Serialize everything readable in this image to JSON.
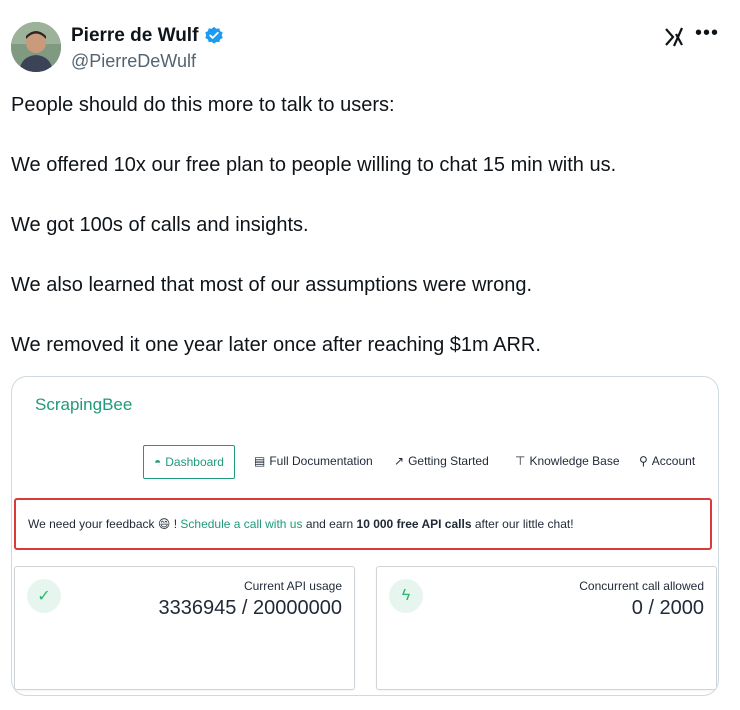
{
  "author": {
    "name": "Pierre de Wulf",
    "handle": "@PierreDeWulf"
  },
  "icons": {
    "verified": "verified-badge-icon",
    "x_logo": "x-grok-logo-icon",
    "more": "more-options-icon"
  },
  "tweet": {
    "lines": [
      "People should do this more to talk to users:",
      "We offered 10x our free plan to people willing to chat 15 min with us.",
      "We got 100s of calls and insights.",
      "We also learned that most of our assumptions were wrong.",
      "We removed it one year later once after reaching $1m ARR."
    ]
  },
  "screenshot": {
    "brand": "ScrapingBee",
    "nav": [
      {
        "label": "Dashboard",
        "icon": "dashboard-gauge-icon",
        "active": true
      },
      {
        "label": "Full Documentation",
        "icon": "book-icon",
        "active": false
      },
      {
        "label": "Getting Started",
        "icon": "wand-icon",
        "active": false
      },
      {
        "label": "Knowledge Base",
        "icon": "pin-icon",
        "active": false
      },
      {
        "label": "Account",
        "icon": "user-icon",
        "active": false
      }
    ],
    "alert": {
      "prefix": "We need your feedback",
      "emoji": "😄",
      "bang": " ! ",
      "link": "Schedule a call with us",
      "middle": " and earn ",
      "bold": "10 000 free API calls",
      "suffix": " after our little chat!"
    },
    "stats": [
      {
        "label": "Current API usage",
        "value": "3336945 / 20000000",
        "icon": "check-icon"
      },
      {
        "label": "Concurrent call allowed",
        "value": "0 / 2000",
        "icon": "bolt-icon"
      }
    ]
  },
  "colors": {
    "brand_green": "#1f9a7a",
    "alert_red": "#d93a3a",
    "verified_blue": "#1d9bf0",
    "muted": "#536471"
  }
}
